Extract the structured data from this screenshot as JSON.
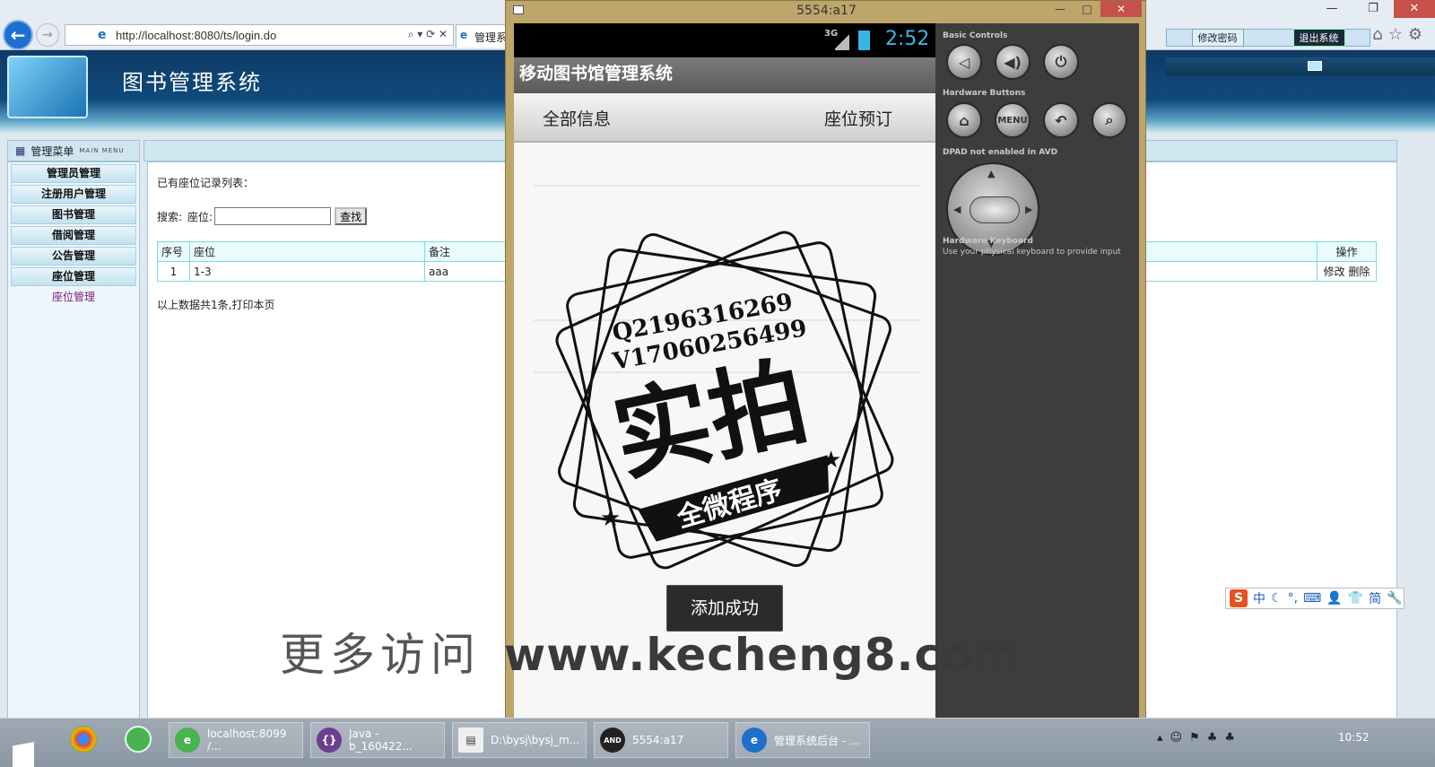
{
  "browser": {
    "url": "http://localhost:8080/ts/login.do",
    "tab_label": "管理系",
    "back_icon": "arrow-left-icon",
    "forward_icon": "arrow-right-icon"
  },
  "site": {
    "title": "图书管理系统",
    "change_password": "修改密码",
    "logout": "退出系统"
  },
  "menu": {
    "header": "管理菜单",
    "header_en": "MAIN MENU",
    "items": [
      "管理员管理",
      "注册用户管理",
      "图书管理",
      "借阅管理",
      "公告管理",
      "座位管理"
    ],
    "sub_item": "座位管理"
  },
  "content": {
    "list_title": "已有座位记录列表：",
    "search_label": "搜索:",
    "seat_label": "座位:",
    "search_value": "",
    "search_button": "查找",
    "table": {
      "headers": [
        "序号",
        "座位",
        "备注",
        "操作"
      ],
      "rows": [
        {
          "no": "1",
          "seat": "1-3",
          "remark": "aaa",
          "edit": "修改",
          "delete": "删除"
        }
      ]
    },
    "summary": "以上数据共1条,打印本页"
  },
  "emulator": {
    "window_title": "5554:a17",
    "net_type": "3G",
    "clock": "2:52",
    "app_title": "移动图书馆管理系统",
    "tabs": [
      "全部信息",
      "座位预订"
    ],
    "toast": "添加成功",
    "panel": {
      "basic_controls": "Basic Controls",
      "hardware_buttons": "Hardware Buttons",
      "dpad_label": "DPAD not enabled in AVD",
      "keyboard_label": "Hardware Keyboard",
      "keyboard_desc": "Use your physical keyboard to provide input",
      "menu_label": "MENU"
    }
  },
  "stamp": {
    "line1": "Q2196316269",
    "line2": "V17060256499",
    "big_text": "实拍",
    "banner": "全微程序"
  },
  "watermark": {
    "cn": "更多访问",
    "url": "www.kecheng8.com"
  },
  "ime": {
    "lang": "中",
    "mode": "简"
  },
  "taskbar": {
    "tasks": [
      "localhost:8099 /...",
      "Java - b_160422...",
      "D:\\bysj\\bysj_m...",
      "5554:a17",
      "管理系统后台 - ..."
    ],
    "clock": "10:52"
  }
}
